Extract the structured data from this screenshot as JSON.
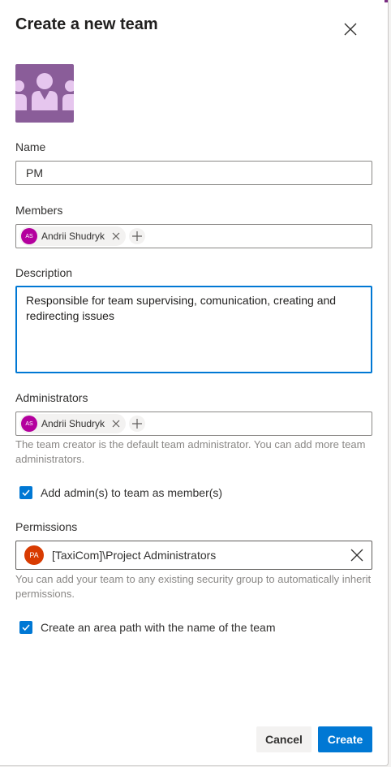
{
  "dialog": {
    "title": "Create a new team"
  },
  "icons": {
    "close": "close-icon",
    "team_image": "team-people-icon",
    "remove": "remove-icon",
    "add": "add-icon",
    "check": "checkmark-icon"
  },
  "colors": {
    "accent": "#0078d4",
    "member_avatar": "#b4009e",
    "permission_avatar": "#d83b01",
    "team_image_bg": "#8a5d99",
    "team_image_fg": "#e6c6ee"
  },
  "name": {
    "label": "Name",
    "value": "PM"
  },
  "members": {
    "label": "Members",
    "people": [
      {
        "initials": "AS",
        "name": "Andrii Shudryk"
      }
    ]
  },
  "description": {
    "label": "Description",
    "value": "Responsible for team supervising, comunication, creating and redirecting issues"
  },
  "administrators": {
    "label": "Administrators",
    "people": [
      {
        "initials": "AS",
        "name": "Andrii Shudryk"
      }
    ],
    "helper": "The team creator is the default team administrator. You can add more team administrators."
  },
  "add_admins_checkbox": {
    "label": "Add admin(s) to team as member(s)",
    "checked": true
  },
  "permissions": {
    "label": "Permissions",
    "group": {
      "initials": "PA",
      "name": "[TaxiCom]\\Project Administrators"
    },
    "helper": "You can add your team to any existing security group to automatically inherit permissions."
  },
  "area_path_checkbox": {
    "label": "Create an area path with the name of the team",
    "checked": true
  },
  "footer": {
    "cancel_label": "Cancel",
    "create_label": "Create"
  }
}
